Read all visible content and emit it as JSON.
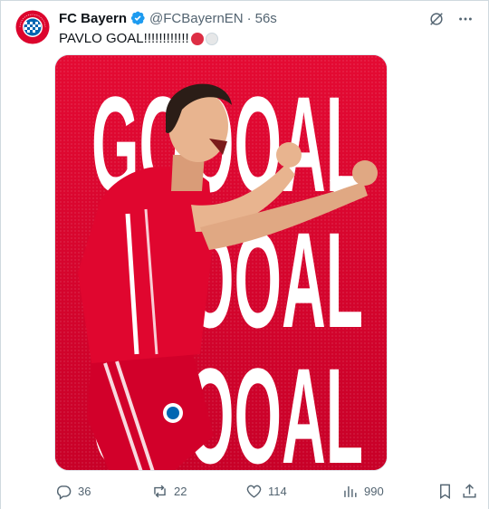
{
  "tweet": {
    "display_name": "FC Bayern",
    "handle": "@FCBayernEN",
    "separator": "·",
    "time": "56s",
    "text": "PAVLO GOAL!!!!!!!!!!!!",
    "emoji": [
      "red-circle",
      "white-circle"
    ],
    "verified": true,
    "avatar_text": "FC BAYERN MÜNCHEN"
  },
  "media": {
    "word": "GOOOAL",
    "rows": 3,
    "background_color": "#dc052d",
    "text_color": "#ffffff"
  },
  "actions": {
    "replies": "36",
    "reposts": "22",
    "likes": "114",
    "views": "990"
  },
  "colors": {
    "brand_red": "#dc052d",
    "verified_blue": "#1d9bf0",
    "muted": "#536471"
  }
}
